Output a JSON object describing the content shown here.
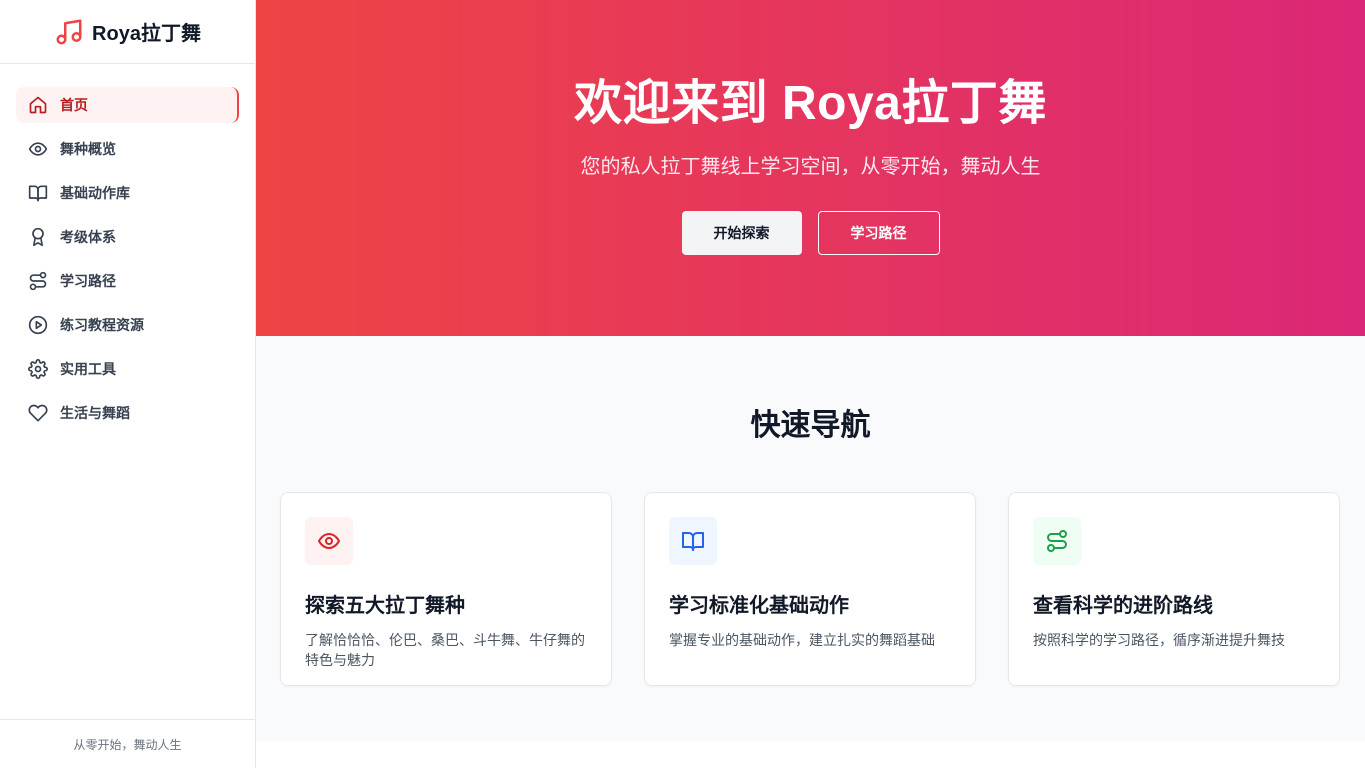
{
  "brand": {
    "title": "Roya拉丁舞",
    "icon": "music-note-icon",
    "color": "#ef4444"
  },
  "sidebar": {
    "items": [
      {
        "label": "首页",
        "icon": "home-icon",
        "active": true
      },
      {
        "label": "舞种概览",
        "icon": "eye-icon",
        "active": false
      },
      {
        "label": "基础动作库",
        "icon": "book-open-icon",
        "active": false
      },
      {
        "label": "考级体系",
        "icon": "award-icon",
        "active": false
      },
      {
        "label": "学习路径",
        "icon": "route-icon",
        "active": false
      },
      {
        "label": "练习教程资源",
        "icon": "play-circle-icon",
        "active": false
      },
      {
        "label": "实用工具",
        "icon": "gear-icon",
        "active": false
      },
      {
        "label": "生活与舞蹈",
        "icon": "heart-icon",
        "active": false
      }
    ],
    "footer": "从零开始，舞动人生"
  },
  "hero": {
    "title": "欢迎来到 Roya拉丁舞",
    "subtitle": "您的私人拉丁舞线上学习空间，从零开始，舞动人生",
    "primary_button": "开始探索",
    "secondary_button": "学习路径",
    "gradient_from": "#ef4444",
    "gradient_to": "#db2777"
  },
  "quick_nav": {
    "title": "快速导航",
    "cards": [
      {
        "title": "探索五大拉丁舞种",
        "desc": "了解恰恰恰、伦巴、桑巴、斗牛舞、牛仔舞的特色与魅力",
        "icon": "eye-icon",
        "icon_color": "#dc2626",
        "icon_bg": "#fef2f2"
      },
      {
        "title": "学习标准化基础动作",
        "desc": "掌握专业的基础动作，建立扎实的舞蹈基础",
        "icon": "book-open-icon",
        "icon_color": "#2563eb",
        "icon_bg": "#eff6ff"
      },
      {
        "title": "查看科学的进阶路线",
        "desc": "按照科学的学习路径，循序渐进提升舞技",
        "icon": "route-icon",
        "icon_color": "#16a34a",
        "icon_bg": "#f0fdf4"
      }
    ]
  }
}
